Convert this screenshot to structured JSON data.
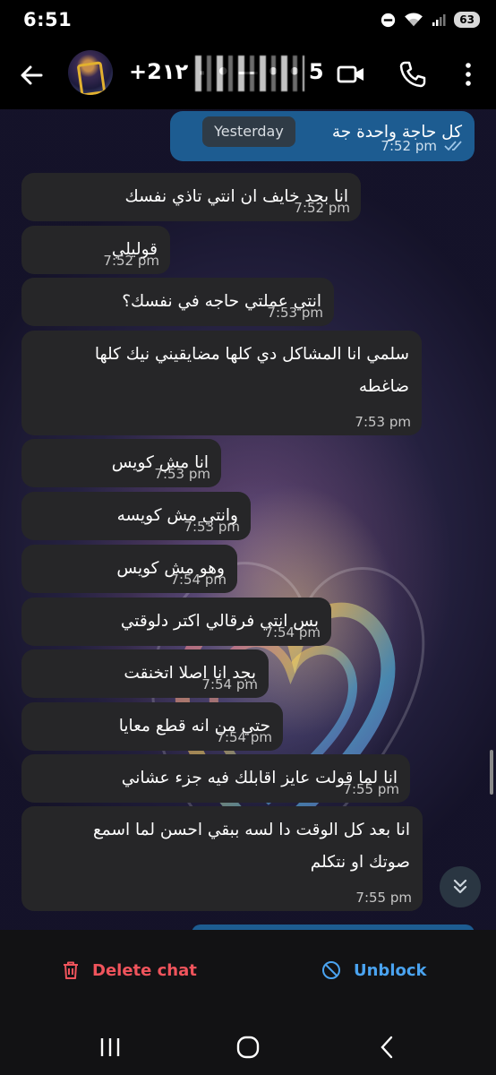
{
  "status_bar": {
    "time": "6:51",
    "battery": "63"
  },
  "header": {
    "contact_name": "+2٠ ١٢ • — • • 5"
  },
  "chat": {
    "date_divider": "Yesterday",
    "sent_message": {
      "text": "كل حاجة واحدة جة",
      "time": "7:52 pm"
    },
    "messages": [
      {
        "text": "انا بجد خايف ان انتي تاذي نفسك",
        "time": "7:52 pm"
      },
      {
        "text": "قوليلي",
        "time": "7:52 pm"
      },
      {
        "text": "انتي عملتي حاجه في نفسك؟",
        "time": "7:53 pm"
      },
      {
        "text": "سلمي انا المشاكل دي كلها مضايقيني نيك كلها",
        "text2": "ضاغطه",
        "time": "7:53 pm"
      },
      {
        "text": "انا مش كويس",
        "time": "7:53 pm"
      },
      {
        "text": "وانتي مش كويسه",
        "time": "7:53 pm"
      },
      {
        "text": "وهو مش كويس",
        "time": "7:54 pm"
      },
      {
        "text": "بس انتي فرقالي اكتر دلوقتي",
        "time": "7:54 pm"
      },
      {
        "text": "بجد انا اصلا اتخنقت",
        "time": "7:54 pm"
      },
      {
        "text": "حتي من انه قطع معايا",
        "time": "7:54 pm"
      },
      {
        "text": "انا لما قولت عايز اقابلك فيه جزء عشاني",
        "time": "7:55 pm"
      },
      {
        "text": "انا بعد كل الوقت دا لسه ببقي احسن لما اسمع",
        "text2": "صوتك او نتكلم",
        "time": "7:55 pm"
      }
    ]
  },
  "actions": {
    "delete_label": "Delete chat",
    "unblock_label": "Unblock"
  },
  "colors": {
    "delete": "#f0545c",
    "unblock": "#4aa3f0",
    "bubble_received": "#262628",
    "bubble_sent": "#1d5c91"
  },
  "icons": [
    "back-arrow-icon",
    "video-call-icon",
    "phone-icon",
    "more-options-icon",
    "scroll-down-icon",
    "trash-icon",
    "block-icon",
    "recent-apps-icon",
    "home-icon",
    "back-nav-icon"
  ]
}
